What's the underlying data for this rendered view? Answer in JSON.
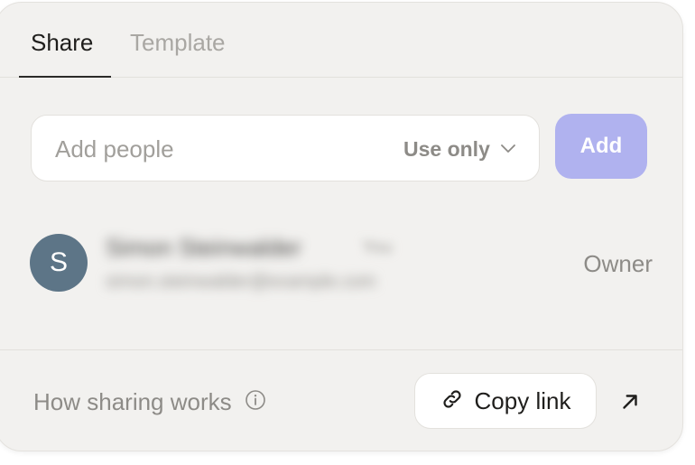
{
  "tabs": [
    {
      "label": "Share",
      "active": true
    },
    {
      "label": "Template",
      "active": false
    }
  ],
  "invite": {
    "placeholder": "Add people",
    "permission": "Use only",
    "add_label": "Add"
  },
  "member": {
    "initial": "S",
    "name": "Simon Steinwalder",
    "you_tag": "You",
    "email": "simon.steinwalder@example.com",
    "role": "Owner"
  },
  "footer": {
    "help_label": "How sharing works",
    "copy_label": "Copy link"
  },
  "icons": {
    "chevron": "chevron-down-icon",
    "info": "info-icon",
    "link": "link-icon",
    "open": "arrow-up-right-icon"
  },
  "colors": {
    "add_button": "#b0b2ef",
    "avatar": "#5d7587",
    "panel_bg": "#f2f1ef"
  }
}
